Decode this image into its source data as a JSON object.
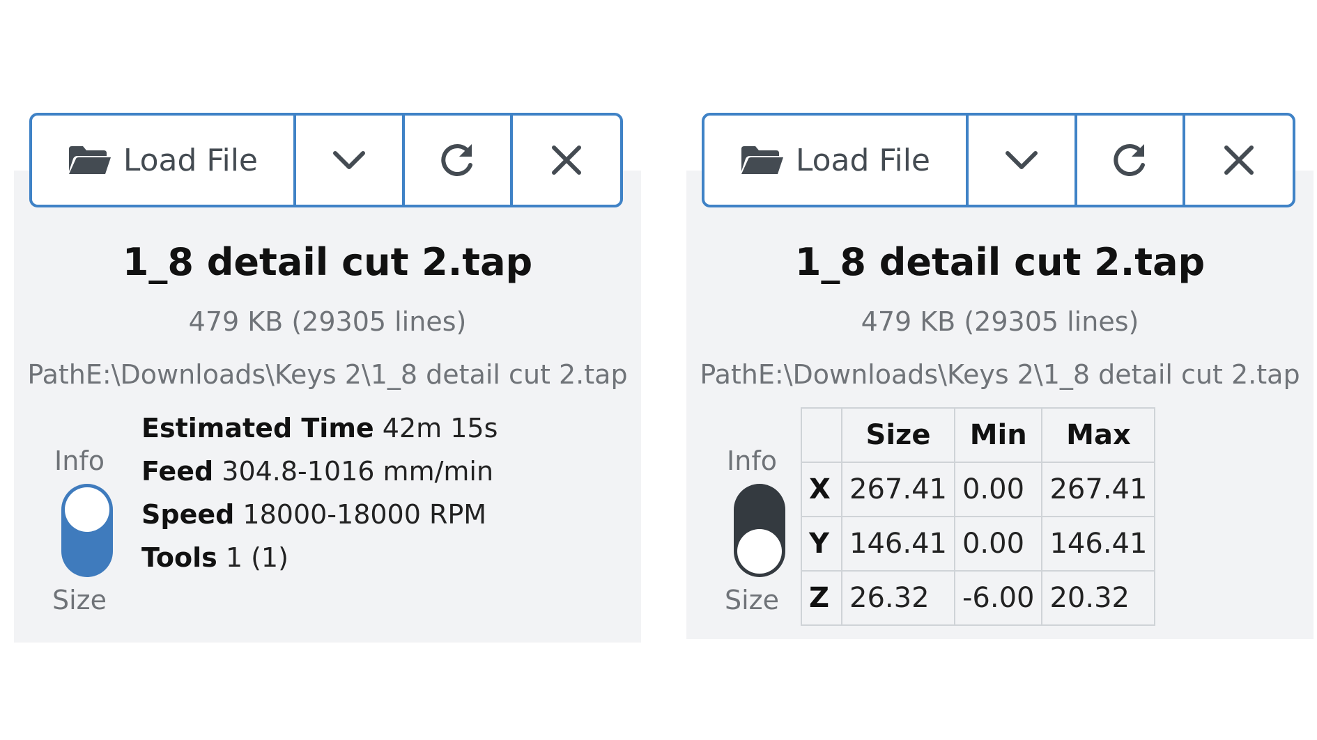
{
  "left_panel": {
    "toolbar": {
      "load_label": "Load File",
      "icons": [
        "folder-open-icon",
        "chevron-down-icon",
        "reload-icon",
        "close-icon"
      ]
    },
    "file": {
      "name": "1_8 detail cut 2.tap",
      "size": "479 KB (29305 lines)",
      "path": "PathE:\\Downloads\\Keys 2\\1_8 detail cut 2.tap"
    },
    "switch": {
      "top_label": "Info",
      "bottom_label": "Size",
      "selected": "Info"
    },
    "info": [
      {
        "label": "Estimated Time",
        "value": "42m 15s"
      },
      {
        "label": "Feed",
        "value": "304.8-1016 mm/min"
      },
      {
        "label": "Speed",
        "value": "18000-18000 RPM"
      },
      {
        "label": "Tools",
        "value": "1 (1)"
      }
    ]
  },
  "right_panel": {
    "toolbar": {
      "load_label": "Load File",
      "icons": [
        "folder-open-icon",
        "chevron-down-icon",
        "reload-icon",
        "close-icon"
      ]
    },
    "file": {
      "name": "1_8 detail cut 2.tap",
      "size": "479 KB (29305 lines)",
      "path": "PathE:\\Downloads\\Keys 2\\1_8 detail cut 2.tap"
    },
    "switch": {
      "top_label": "Info",
      "bottom_label": "Size",
      "selected": "Size"
    },
    "table": {
      "headers": [
        "",
        "Size",
        "Min",
        "Max"
      ],
      "rows": [
        {
          "axis": "X",
          "size": "267.41",
          "min": "0.00",
          "max": "267.41"
        },
        {
          "axis": "Y",
          "size": "146.41",
          "min": "0.00",
          "max": "146.41"
        },
        {
          "axis": "Z",
          "size": "26.32",
          "min": "-6.00",
          "max": "20.32"
        }
      ]
    }
  },
  "colors": {
    "accent": "#3f82c6",
    "toggle_on": "#3f7bbd",
    "toggle_off": "#343a40",
    "panel_bg": "#f2f3f5"
  }
}
